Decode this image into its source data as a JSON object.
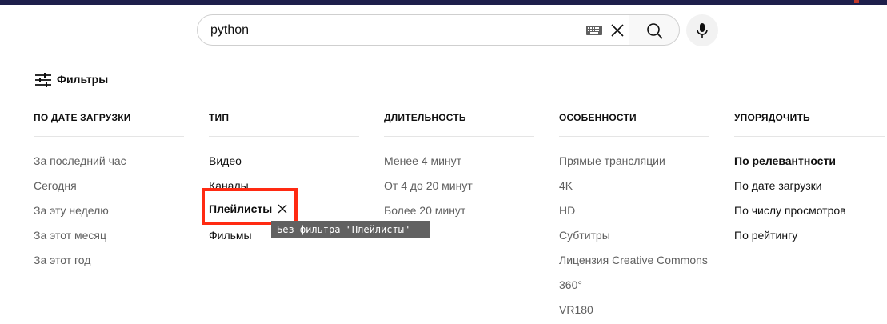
{
  "search": {
    "query": "python"
  },
  "filters_label": "Фильтры",
  "columns": [
    {
      "header": "ПО ДАТЕ ЗАГРУЗКИ",
      "options": [
        "За последний час",
        "Сегодня",
        "За эту неделю",
        "За этот месяц",
        "За этот год"
      ]
    },
    {
      "header": "ТИП",
      "options": [
        "Видео",
        "Каналы",
        "Плейлисты",
        "Фильмы"
      ],
      "selected": "Плейлисты"
    },
    {
      "header": "ДЛИТЕЛЬНОСТЬ",
      "options": [
        "Менее 4 минут",
        "От 4 до 20 минут",
        "Более 20 минут"
      ]
    },
    {
      "header": "ОСОБЕННОСТИ",
      "options": [
        "Прямые трансляции",
        "4K",
        "HD",
        "Субтитры",
        "Лицензия Creative Commons",
        "360°",
        "VR180"
      ]
    },
    {
      "header": "УПОРЯДОЧИТЬ",
      "options": [
        "По релевантности",
        "По дате загрузки",
        "По числу просмотров",
        "По рейтингу"
      ],
      "selected": "По релевантности"
    }
  ],
  "tooltip": "Без фильтра \"Плейлисты\"",
  "colors": {
    "highlight": "#ff2a12",
    "tooltip_bg": "#616161",
    "top_bar": "#1e1f4b"
  },
  "icons": [
    "keyboard-icon",
    "close-icon",
    "search-icon",
    "mic-icon",
    "filter-sliders-icon"
  ]
}
